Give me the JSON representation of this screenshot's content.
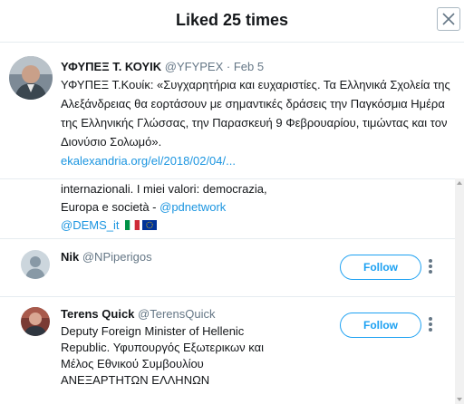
{
  "modal": {
    "title": "Liked 25 times",
    "close_icon": "close-icon"
  },
  "tweet": {
    "name": "ΥΦΥΠΕΞ Τ. ΚΟΥΙΚ",
    "handle": "@YFYPEX",
    "separator": " · ",
    "date": "Feb 5",
    "text": "ΥΦΥΠΕΞ Τ.Κουίκ: «Συγχαρητήρια και ευχαριστίες. Τα Ελληνικά Σχολεία της Αλεξάνδρειας θα εορτάσουν με σημαντικές δράσεις την Παγκόσμια Ημέρα της Ελληνικής Γλώσσας, την Παρασκευή 9 Φεβρουαρίου, τιμώντας και τον Διονύσιο Σολωμό».",
    "link": "ekalexandria.org/el/2018/02/04/..."
  },
  "partial_bio": {
    "line1": "internazionali. I miei valori: democrazia,",
    "line2_text": "Europa e società - ",
    "line2_link": "@pdnetwork",
    "line3_link": "@DEMS_it",
    "flags": [
      "italy-flag-icon",
      "eu-flag-icon"
    ]
  },
  "users": [
    {
      "name": "Nik",
      "handle": "@NPiperigos",
      "follow_label": "Follow",
      "bio": []
    },
    {
      "name": "Terens Quick",
      "handle": "@TerensQuick",
      "follow_label": "Follow",
      "bio": [
        "Deputy Foreign Minister of Hellenic",
        "Republic. Υφυπουργός Εξωτερικων και",
        "Μέλος Εθνικού Συμβουλίου",
        "ΑΝΕΞΑΡΤΗΤΩΝ ΕΛΛΗΝΩΝ"
      ]
    }
  ],
  "colors": {
    "accent": "#1da1f2",
    "link": "#1b95e0",
    "muted": "#657786",
    "border": "#e6ecf0"
  }
}
